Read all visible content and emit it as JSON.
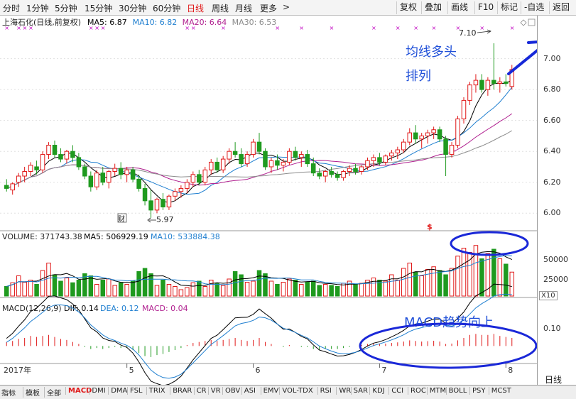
{
  "toolbar": {
    "periods": [
      {
        "label": "分时"
      },
      {
        "label": "1分钟"
      },
      {
        "label": "5分钟"
      },
      {
        "label": "15分钟"
      },
      {
        "label": "30分钟"
      },
      {
        "label": "60分钟"
      },
      {
        "label": "日线",
        "active": true
      },
      {
        "label": "周线"
      },
      {
        "label": "月线"
      },
      {
        "label": "更多"
      }
    ],
    "more_arrow": ">",
    "buttons": [
      {
        "label": "复权"
      },
      {
        "label": "叠加"
      },
      {
        "label": "画线"
      },
      {
        "label": "F10"
      },
      {
        "label": "标记"
      },
      {
        "label": "-自选"
      },
      {
        "label": "返回"
      }
    ]
  },
  "kline": {
    "stock_name": "上海石化(日线,前复权)",
    "ma": [
      {
        "label": "MA5: 6.87",
        "color": "#000000"
      },
      {
        "label": "MA10: 6.82",
        "color": "#1f7fd0"
      },
      {
        "label": "MA20: 6.64",
        "color": "#b01f8f"
      },
      {
        "label": "MA30: 6.53",
        "color": "#8c8c8c"
      }
    ],
    "price_ticks": [
      "7.00",
      "6.80",
      "6.60",
      "6.40",
      "6.20",
      "6.00"
    ],
    "max_label": "7.10",
    "min_label": "5.97",
    "event_marks": [
      "财",
      "$"
    ],
    "annotation_line1": "均线多头",
    "annotation_line2": "排列"
  },
  "volume": {
    "label": "VOLUME: 371743.38",
    "ma5": "MA5: 506929.19",
    "ma10": "MA10: 533884.38",
    "ticks": [
      "50000",
      "25000"
    ],
    "unit": "X10"
  },
  "macd": {
    "label": "MACD(12,26,9)",
    "dif": "DIF: 0.14",
    "dea": "DEA: 0.12",
    "macd_val": "MACD: 0.04",
    "tick": "0.10",
    "annotation": "MACD趋势向上"
  },
  "date_axis": [
    "2017年",
    "5",
    "6",
    "7",
    "8"
  ],
  "period_indicator": "日线",
  "corner_controls": [
    "+",
    "-"
  ],
  "indicator_tabs": [
    "指标",
    "模板",
    "全部",
    "MACD",
    "DMI",
    "DMA",
    "FSL",
    "TRIX",
    "BRAR",
    "CR",
    "VR",
    "OBV",
    "ASI",
    "EMV",
    "VOL-TDX",
    "RSI",
    "WR",
    "SAR",
    "KDJ",
    "CCI",
    "ROC",
    "MTM",
    "BOLL",
    "PSY",
    "MCST"
  ],
  "active_indicator": "MACD",
  "chart_data": {
    "type": "candlestick",
    "ohlc": [
      [
        6.18,
        6.22,
        6.14,
        6.16
      ],
      [
        6.15,
        6.2,
        6.12,
        6.19
      ],
      [
        6.2,
        6.26,
        6.17,
        6.24
      ],
      [
        6.24,
        6.3,
        6.2,
        6.27
      ],
      [
        6.27,
        6.33,
        6.24,
        6.31
      ],
      [
        6.3,
        6.34,
        6.25,
        6.28
      ],
      [
        6.28,
        6.4,
        6.26,
        6.38
      ],
      [
        6.38,
        6.46,
        6.35,
        6.44
      ],
      [
        6.44,
        6.47,
        6.36,
        6.38
      ],
      [
        6.38,
        6.42,
        6.33,
        6.35
      ],
      [
        6.35,
        6.41,
        6.32,
        6.4
      ],
      [
        6.4,
        6.44,
        6.33,
        6.36
      ],
      [
        6.36,
        6.39,
        6.28,
        6.3
      ],
      [
        6.3,
        6.32,
        6.22,
        6.24
      ],
      [
        6.24,
        6.27,
        6.14,
        6.17
      ],
      [
        6.17,
        6.28,
        6.15,
        6.26
      ],
      [
        6.26,
        6.3,
        6.18,
        6.2
      ],
      [
        6.2,
        6.28,
        6.16,
        6.27
      ],
      [
        6.27,
        6.32,
        6.24,
        6.29
      ],
      [
        6.29,
        6.33,
        6.22,
        6.25
      ],
      [
        6.25,
        6.3,
        6.2,
        6.28
      ],
      [
        6.28,
        6.3,
        6.2,
        6.22
      ],
      [
        6.22,
        6.25,
        6.14,
        6.16
      ],
      [
        6.16,
        6.19,
        6.05,
        6.08
      ],
      [
        6.08,
        6.15,
        5.97,
        6.02
      ],
      [
        6.02,
        6.1,
        6.0,
        6.09
      ],
      [
        6.09,
        6.13,
        6.02,
        6.04
      ],
      [
        6.04,
        6.12,
        6.02,
        6.11
      ],
      [
        6.11,
        6.16,
        6.08,
        6.14
      ],
      [
        6.14,
        6.18,
        6.1,
        6.16
      ],
      [
        6.16,
        6.22,
        6.13,
        6.2
      ],
      [
        6.2,
        6.27,
        6.17,
        6.25
      ],
      [
        6.25,
        6.28,
        6.18,
        6.2
      ],
      [
        6.2,
        6.3,
        6.18,
        6.28
      ],
      [
        6.28,
        6.35,
        6.25,
        6.33
      ],
      [
        6.33,
        6.36,
        6.26,
        6.28
      ],
      [
        6.28,
        6.37,
        6.26,
        6.35
      ],
      [
        6.35,
        6.42,
        6.32,
        6.4
      ],
      [
        6.4,
        6.46,
        6.36,
        6.38
      ],
      [
        6.38,
        6.42,
        6.3,
        6.32
      ],
      [
        6.32,
        6.4,
        6.3,
        6.38
      ],
      [
        6.38,
        6.48,
        6.36,
        6.46
      ],
      [
        6.46,
        6.52,
        6.38,
        6.4
      ],
      [
        6.4,
        6.42,
        6.28,
        6.3
      ],
      [
        6.3,
        6.36,
        6.26,
        6.34
      ],
      [
        6.34,
        6.38,
        6.28,
        6.31
      ],
      [
        6.31,
        6.35,
        6.27,
        6.33
      ],
      [
        6.33,
        6.42,
        6.31,
        6.4
      ],
      [
        6.4,
        6.43,
        6.34,
        6.36
      ],
      [
        6.36,
        6.4,
        6.3,
        6.38
      ],
      [
        6.38,
        6.41,
        6.3,
        6.32
      ],
      [
        6.32,
        6.36,
        6.24,
        6.26
      ],
      [
        6.26,
        6.29,
        6.22,
        6.24
      ],
      [
        6.24,
        6.28,
        6.2,
        6.27
      ],
      [
        6.27,
        6.3,
        6.23,
        6.25
      ],
      [
        6.25,
        6.27,
        6.21,
        6.23
      ],
      [
        6.23,
        6.28,
        6.21,
        6.27
      ],
      [
        6.27,
        6.31,
        6.24,
        6.29
      ],
      [
        6.29,
        6.32,
        6.25,
        6.27
      ],
      [
        6.27,
        6.31,
        6.25,
        6.3
      ],
      [
        6.3,
        6.36,
        6.28,
        6.34
      ],
      [
        6.34,
        6.38,
        6.3,
        6.36
      ],
      [
        6.36,
        6.39,
        6.31,
        6.33
      ],
      [
        6.33,
        6.38,
        6.31,
        6.37
      ],
      [
        6.37,
        6.41,
        6.34,
        6.39
      ],
      [
        6.39,
        6.43,
        6.35,
        6.41
      ],
      [
        6.41,
        6.48,
        6.39,
        6.46
      ],
      [
        6.46,
        6.55,
        6.44,
        6.52
      ],
      [
        6.52,
        6.57,
        6.45,
        6.48
      ],
      [
        6.48,
        6.52,
        6.42,
        6.5
      ],
      [
        6.5,
        6.54,
        6.45,
        6.52
      ],
      [
        6.52,
        6.56,
        6.48,
        6.54
      ],
      [
        6.54,
        6.56,
        6.46,
        6.48
      ],
      [
        6.48,
        6.5,
        6.24,
        6.38
      ],
      [
        6.38,
        6.46,
        6.36,
        6.44
      ],
      [
        6.44,
        6.63,
        6.42,
        6.61
      ],
      [
        6.61,
        6.75,
        6.58,
        6.73
      ],
      [
        6.73,
        6.85,
        6.7,
        6.83
      ],
      [
        6.83,
        6.9,
        6.78,
        6.86
      ],
      [
        6.86,
        6.9,
        6.78,
        6.8
      ],
      [
        6.8,
        6.88,
        6.76,
        6.86
      ],
      [
        6.86,
        7.1,
        6.8,
        6.84
      ],
      [
        6.84,
        6.88,
        6.78,
        6.85
      ],
      [
        6.85,
        6.9,
        6.82,
        6.84
      ],
      [
        6.82,
        6.96,
        6.8,
        6.93
      ]
    ],
    "volume": [
      18,
      25,
      38,
      26,
      30,
      22,
      48,
      62,
      40,
      28,
      34,
      25,
      30,
      42,
      38,
      22,
      30,
      32,
      20,
      25,
      22,
      28,
      46,
      52,
      42,
      20,
      30,
      22,
      18,
      12,
      16,
      25,
      28,
      18,
      30,
      24,
      20,
      32,
      46,
      40,
      26,
      28,
      48,
      42,
      28,
      22,
      26,
      32,
      30,
      22,
      26,
      28,
      20,
      22,
      20,
      18,
      24,
      28,
      22,
      24,
      30,
      34,
      30,
      28,
      40,
      30,
      52,
      62,
      45,
      38,
      50,
      55,
      48,
      40,
      52,
      75,
      90,
      82,
      95,
      70,
      80,
      88,
      70,
      60,
      45
    ],
    "volume_unit": "X10",
    "macd_hist": [
      0.02,
      0.025,
      0.035,
      0.04,
      0.05,
      0.045,
      0.05,
      0.055,
      0.045,
      0.035,
      0.03,
      0.02,
      0.01,
      -0.005,
      -0.015,
      -0.01,
      -0.015,
      -0.01,
      -0.005,
      -0.01,
      -0.01,
      -0.02,
      -0.035,
      -0.05,
      -0.055,
      -0.045,
      -0.04,
      -0.03,
      -0.02,
      -0.01,
      0.005,
      0.015,
      0.02,
      0.025,
      0.03,
      0.025,
      0.03,
      0.035,
      0.04,
      0.03,
      0.025,
      0.03,
      0.04,
      0.02,
      0.01,
      0.0,
      -0.005,
      0.005,
      0.0,
      -0.005,
      -0.005,
      -0.015,
      -0.02,
      -0.015,
      -0.015,
      -0.015,
      -0.01,
      -0.005,
      0.0,
      0.005,
      0.01,
      0.012,
      0.01,
      0.012,
      0.015,
      0.018,
      0.022,
      0.028,
      0.025,
      0.022,
      0.024,
      0.026,
      0.022,
      0.01,
      0.012,
      0.028,
      0.04,
      0.055,
      0.06,
      0.055,
      0.055,
      0.06,
      0.05,
      0.045,
      0.04
    ],
    "macd_range": [
      -0.08,
      0.16
    ],
    "macd_last": {
      "dif": 0.14,
      "dea": 0.12,
      "macd": 0.04
    },
    "ma_last": {
      "ma5": 6.87,
      "ma10": 6.82,
      "ma20": 6.64,
      "ma30": 6.53
    },
    "ylim": [
      5.9,
      7.15
    ],
    "x_labels": [
      "2017年",
      "5",
      "6",
      "7",
      "8"
    ]
  }
}
